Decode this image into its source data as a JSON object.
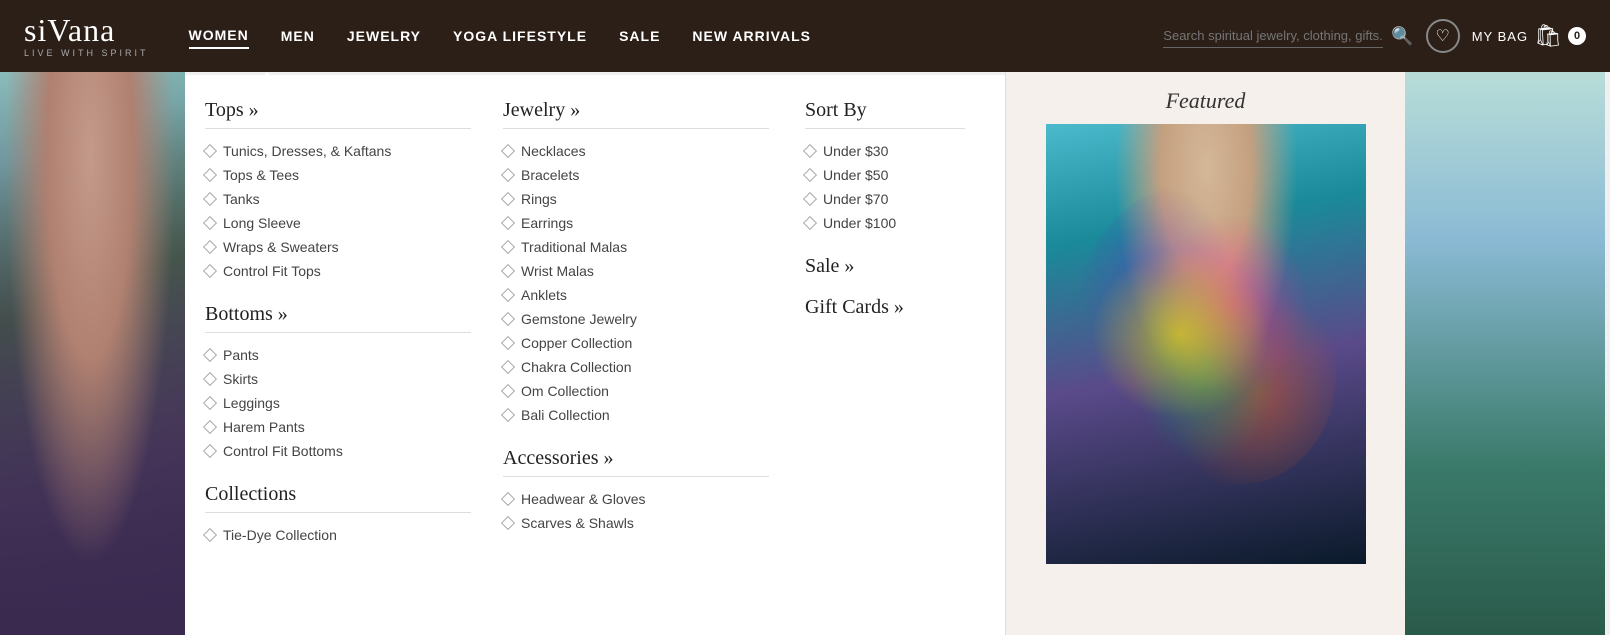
{
  "header": {
    "logo_text": "siVana",
    "logo_tagline": "Live With Spirit",
    "nav_items": [
      {
        "label": "WOMEN",
        "active": true
      },
      {
        "label": "MEN",
        "active": false
      },
      {
        "label": "JEWELRY",
        "active": false
      },
      {
        "label": "YOGA LIFESTYLE",
        "active": false
      },
      {
        "label": "SALE",
        "active": false
      },
      {
        "label": "NEW ARRIVALS",
        "active": false
      }
    ],
    "search_placeholder": "Search spiritual jewelry, clothing, gifts...",
    "bag_label": "MY BAG",
    "bag_count": "0"
  },
  "menu": {
    "tops_section": {
      "title": "Tops »",
      "items": [
        "Tunics, Dresses, & Kaftans",
        "Tops & Tees",
        "Tanks",
        "Long Sleeve",
        "Wraps & Sweaters",
        "Control Fit Tops"
      ]
    },
    "bottoms_section": {
      "title": "Bottoms »",
      "items": [
        "Pants",
        "Skirts",
        "Leggings",
        "Harem Pants",
        "Control Fit Bottoms"
      ]
    },
    "collections_section": {
      "title": "Collections",
      "items": [
        "Tie-Dye Collection"
      ]
    },
    "jewelry_section": {
      "title": "Jewelry »",
      "items": [
        "Necklaces",
        "Bracelets",
        "Rings",
        "Earrings",
        "Traditional Malas",
        "Wrist Malas",
        "Anklets",
        "Gemstone Jewelry",
        "Copper Collection",
        "Chakra Collection",
        "Om Collection",
        "Bali Collection"
      ]
    },
    "accessories_section": {
      "title": "Accessories »",
      "items": [
        "Headwear & Gloves",
        "Scarves & Shawls"
      ]
    },
    "sort_section": {
      "title": "Sort By",
      "items": [
        "Under $30",
        "Under $50",
        "Under $70",
        "Under $100"
      ]
    },
    "sale_label": "Sale »",
    "gift_cards_label": "Gift Cards »",
    "featured_title": "Featured"
  }
}
